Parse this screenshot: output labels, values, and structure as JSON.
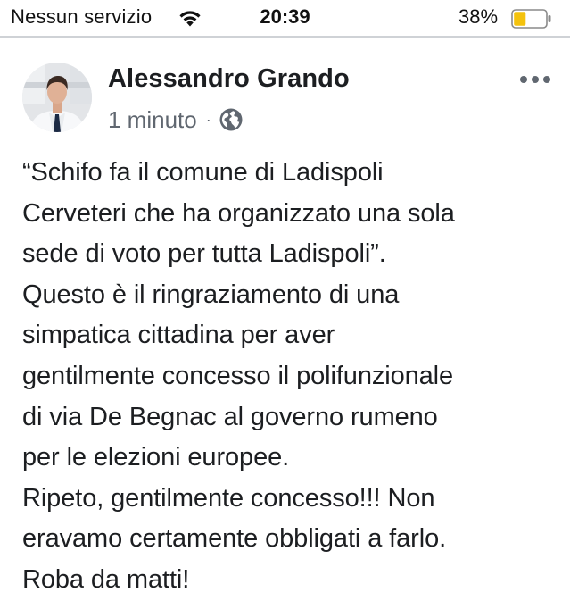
{
  "status_bar": {
    "carrier": "Nessun servizio",
    "time": "20:39",
    "battery_percent": "38%",
    "battery_level": 0.38,
    "battery_color": "#f4c20d",
    "icons": [
      "wifi-icon",
      "battery-icon"
    ]
  },
  "post": {
    "author": "Alessandro Grando",
    "time_label": "1 minuto",
    "separator": "·",
    "privacy_icon": "globe-icon",
    "menu_icon": "more-options-icon",
    "lines": [
      "“Schifo fa il comune di Ladispoli",
      "Cerveteri che ha organizzato una sola",
      "sede di voto per tutta Ladispoli”.",
      "Questo è il ringraziamento di una",
      "simpatica cittadina per aver",
      "gentilmente concesso il polifunzionale",
      "di via De Begnac al governo rumeno",
      "per le elezioni europee.",
      "Ripeto, gentilmente concesso!!! Non",
      "eravamo certamente obbligati a farlo.",
      "Roba da matti!"
    ]
  },
  "colors": {
    "text": "#1c1e21",
    "meta_text": "#606770",
    "divider": "#cfd2d6"
  }
}
